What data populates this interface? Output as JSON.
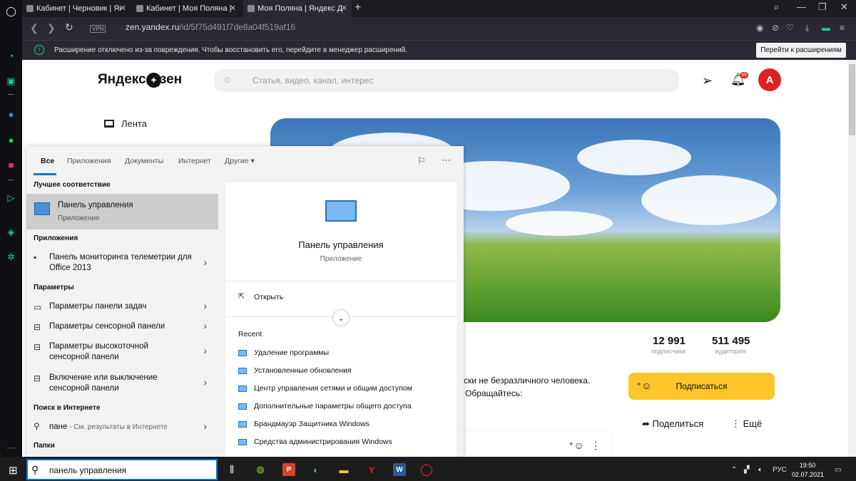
{
  "browser": {
    "tabs": [
      {
        "title": "Кабинет | Черновик | Яндекс"
      },
      {
        "title": "Кабинет | Моя Поляна | Яндекс"
      },
      {
        "title": "Моя Поляна | Яндекс Дзен"
      }
    ],
    "vpn_label": "VPN",
    "url_host": "zen.yandex.ru",
    "url_path": "/id/5f75d491f7de8a04f519af16",
    "infobar_text": "Расширение отключено из-за повреждения. Чтобы восстановить его, перейдите в менеджер расширений.",
    "infobar_button": "Перейти к расширениям"
  },
  "zen": {
    "logo": "Яндекс Дзен",
    "search_placeholder": "Статья, видео, канал, интерес",
    "notif_badge": "99",
    "avatar_letter": "А",
    "feed_label": "Лента",
    "subscribers_num": "12 991",
    "subscribers_label": "подписчики",
    "audience_num": "511 495",
    "audience_label": "аудитория",
    "desc_line1": "ски не безразличного человека.",
    "desc_line2": "Обращайтесь:",
    "subscribe_label": "Подписаться",
    "share_label": "Поделиться",
    "more_label": "Ещё"
  },
  "startmenu": {
    "tabs": [
      "Все",
      "Приложения",
      "Документы",
      "Интернет",
      "Другие"
    ],
    "best_match_header": "Лучшее соответствие",
    "best_title": "Панель управления",
    "best_subtitle": "Приложение",
    "apps_header": "Приложения",
    "app_item": "Панель мониторинга телеметрии для Office 2013",
    "settings_header": "Параметры",
    "settings_items": [
      "Параметры панели задач",
      "Параметры сенсорной панели",
      "Параметры высокоточной сенсорной панели",
      "Включение или выключение сенсорной панели"
    ],
    "web_header": "Поиск в Интернете",
    "web_item": "пане",
    "web_item_hint": " - См. результаты в Интернете",
    "folders_header": "Папки",
    "right_title": "Панель управления",
    "right_subtitle": "Приложение",
    "open_label": "Открыть",
    "recent_header": "Recent",
    "recent": [
      "Удаление программы",
      "Установленные обновления",
      "Центр управления сетями и общим доступом",
      "Дополнительные параметры общего доступа",
      "Брандмауэр Защитника Windows",
      "Средства администрирования Windows"
    ]
  },
  "taskbar": {
    "search_text": "панель управления",
    "lang": "РУС",
    "time": "19:50",
    "date": "02.07.2021"
  },
  "colors": {
    "accent": "#0078d4",
    "zen_yellow": "#fcc62b",
    "opera_green": "#20c997"
  }
}
